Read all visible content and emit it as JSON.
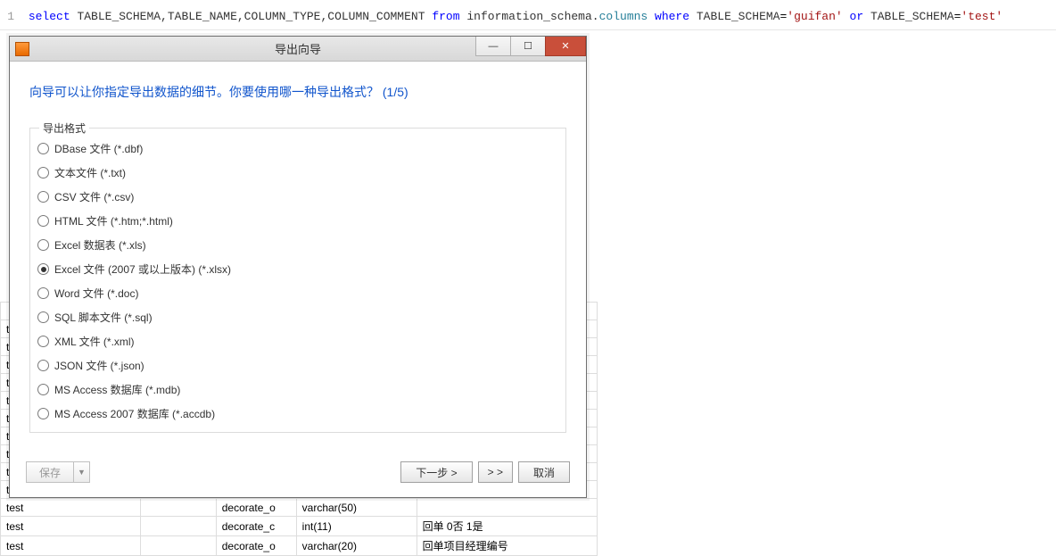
{
  "sql": {
    "line_no": "1",
    "tokens": {
      "select": "select",
      "cols": "TABLE_SCHEMA,TABLE_NAME,COLUMN_TYPE,COLUMN_COMMENT",
      "from": "from",
      "schema": "information_schema",
      "dot": ".",
      "table": "columns",
      "where": "where",
      "cond1_col": "TABLE_SCHEMA",
      "eq": "=",
      "cond1_val": "'guifan'",
      "or": "or",
      "cond2_col": "TABLE_SCHEMA",
      "cond2_val": "'test'"
    }
  },
  "modal": {
    "title": "导出向导",
    "heading": "向导可以让你指定导出数据的细节。你要使用哪一种导出格式？ (1/5)",
    "group_legend": "导出格式",
    "options": [
      {
        "label": "DBase 文件 (*.dbf)",
        "checked": false
      },
      {
        "label": "文本文件 (*.txt)",
        "checked": false
      },
      {
        "label": "CSV 文件 (*.csv)",
        "checked": false
      },
      {
        "label": "HTML 文件 (*.htm;*.html)",
        "checked": false
      },
      {
        "label": "Excel 数据表 (*.xls)",
        "checked": false
      },
      {
        "label": "Excel 文件 (2007 或以上版本) (*.xlsx)",
        "checked": true
      },
      {
        "label": "Word 文件 (*.doc)",
        "checked": false
      },
      {
        "label": "SQL 脚本文件 (*.sql)",
        "checked": false
      },
      {
        "label": "XML 文件 (*.xml)",
        "checked": false
      },
      {
        "label": "JSON 文件 (*.json)",
        "checked": false
      },
      {
        "label": "MS Access 数据库 (*.mdb)",
        "checked": false
      },
      {
        "label": "MS Access 2007 数据库 (*.accdb)",
        "checked": false
      }
    ],
    "footer": {
      "save": "保存",
      "next": "下一步 >",
      "fast_forward": "> >",
      "cancel": "取消"
    },
    "win_buttons": {
      "minimize": "—",
      "maximize": "☐",
      "close": "✕"
    }
  },
  "bg_rows": [
    {
      "c1": "",
      "c2": "",
      "c3": "",
      "c4": "",
      "c5": ""
    },
    {
      "c1": "t",
      "c2": "",
      "c3": "",
      "c4": "",
      "c5": ""
    },
    {
      "c1": "te",
      "c2": "",
      "c3": "",
      "c4": "",
      "c5": ""
    },
    {
      "c1": "te",
      "c2": "",
      "c3": "",
      "c4": "",
      "c5": ""
    },
    {
      "c1": "te",
      "c2": "",
      "c3": "",
      "c4": "",
      "c5": ""
    },
    {
      "c1": "te",
      "c2": "",
      "c3": "",
      "c4": "",
      "c5": ""
    },
    {
      "c1": "te",
      "c2": "",
      "c3": "",
      "c4": "",
      "c5": ""
    },
    {
      "c1": "te",
      "c2": "",
      "c3": "",
      "c4": "",
      "c5": ""
    },
    {
      "c1": "te",
      "c2": "",
      "c3": "",
      "c4": "",
      "c5": ""
    },
    {
      "c1": "te",
      "c2": "",
      "c3": "",
      "c4": "",
      "c5": ""
    },
    {
      "c1": "te",
      "c2": "",
      "c3": "",
      "c4": "",
      "c5": ""
    },
    {
      "c1": "test",
      "c2": "",
      "c3": "decorate_o",
      "c4": "varchar(50)",
      "c5": ""
    },
    {
      "c1": "test",
      "c2": "",
      "c3": "decorate_c",
      "c4": "int(11)",
      "c5": "回单 0否  1是"
    },
    {
      "c1": "test",
      "c2": "",
      "c3": "decorate_o",
      "c4": "varchar(20)",
      "c5": "回单项目经理编号"
    }
  ]
}
